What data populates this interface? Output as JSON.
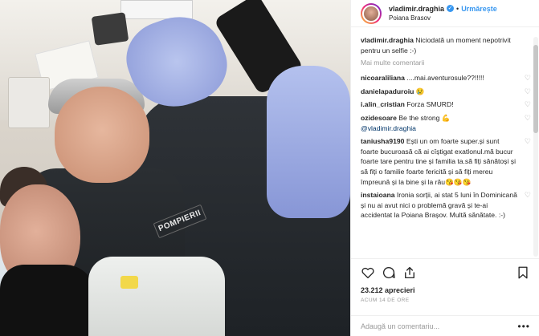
{
  "post": {
    "photo_badge_text": "POMPIERII"
  },
  "header": {
    "username": "vladimir.draghia",
    "separator": "•",
    "follow_label": "Urmărește",
    "location": "Poiana Brasov"
  },
  "caption": {
    "username": "vladimir.draghia",
    "text": " Niciodată un moment nepotrivit pentru un selfie :-)"
  },
  "more_comments_label": "Mai multe comentarii",
  "comments": [
    {
      "username": "nicoaraliliana",
      "text": " ....mai.aventurosule??!!!!!"
    },
    {
      "username": "danielapaduroiu",
      "text": " 😢"
    },
    {
      "username": "i.alin_cristian",
      "text": " Forza SMURD!"
    },
    {
      "username": "ozidesoare",
      "text": " Be the strong 💪",
      "mention": "@vladimir.draghia"
    },
    {
      "username": "taniusha9190",
      "text": " Ești un om foarte super.și sunt foarte bucuroasă că ai cîștigat exatlonul.mă bucur foarte tare pentru tine și familia ta.să fiți sănătoși și să fiți o familie foarte fericită și să fiți mereu împreună și la bine și la rău😘😘😘"
    },
    {
      "username": "instaioana",
      "text": " Ironia sorții, ai stat 5 luni în Dominicană și nu ai avut nici o problemă gravă și te-ai accidentat la Poiana Brașov. Multă sănătate. :-)"
    }
  ],
  "likes": "23.212 aprecieri",
  "time_ago": "ACUM 14 DE ORE",
  "add_comment_placeholder": "Adaugă un comentariu...",
  "more_options": "•••",
  "heart_glyph": "♡",
  "verified_glyph": "✓",
  "colors": {
    "link_blue": "#3897f0",
    "text": "#262626",
    "muted": "#999999",
    "border": "#efefef"
  },
  "icons": [
    "heart-icon",
    "comment-icon",
    "share-icon",
    "bookmark-icon",
    "verified-icon",
    "more-options-icon"
  ]
}
